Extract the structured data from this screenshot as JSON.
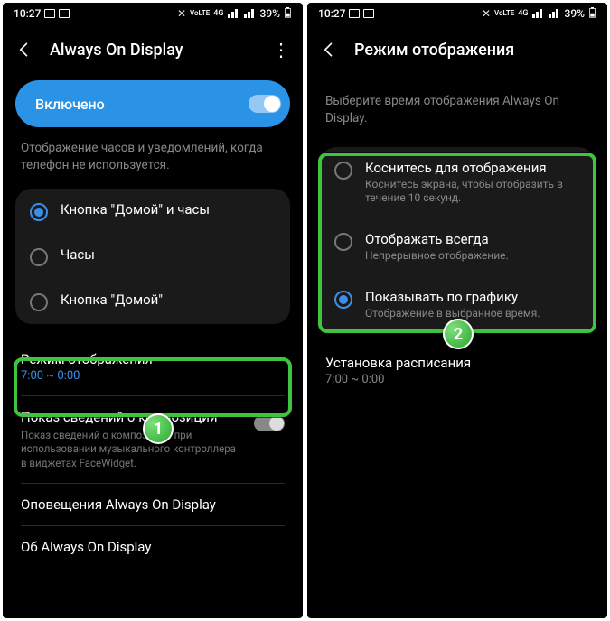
{
  "status": {
    "time": "10:27",
    "net_label": "VoLTE",
    "sig_label": "4G",
    "battery": "39%"
  },
  "left": {
    "title": "Always On Display",
    "toggle_label": "Включено",
    "description": "Отображение часов и уведомлений, когда телефон не используется.",
    "radios": {
      "r1": "Кнопка \"Домой\" и часы",
      "r2": "Часы",
      "r3": "Кнопка \"Домой\""
    },
    "items": {
      "mode_title": "Режим отображения",
      "mode_sub": "7:00 ~ 0:00",
      "comp_title": "Показ сведений о композиции",
      "comp_desc": "Показ сведений о композиции при использовании музыкального контроллера в виджетах FaceWidget.",
      "notif_title": "Оповещения Always On Display",
      "about_title": "Об Always On Display"
    }
  },
  "right": {
    "title": "Режим отображения",
    "description": "Выберите время отображения Always On Display.",
    "radios": {
      "r1_label": "Коснитесь для отображения",
      "r1_sub": "Коснитесь экрана, чтобы отобразить в течение 10 секунд.",
      "r2_label": "Отображать всегда",
      "r2_sub": "Непрерывное отображение.",
      "r3_label": "Показывать по графику",
      "r3_sub": "Отображение в выбранное время."
    },
    "schedule_title": "Установка расписания",
    "schedule_sub": "7:00 ~ 0:00"
  },
  "badges": {
    "b1": "1",
    "b2": "2"
  }
}
